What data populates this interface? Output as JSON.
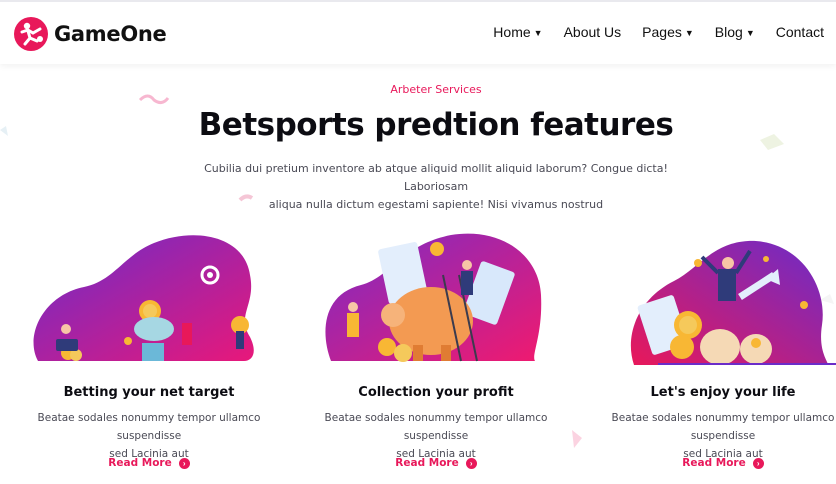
{
  "brand": {
    "name": "GameOne",
    "accent": "#e8185a",
    "purple": "#6b2cc9"
  },
  "nav": {
    "items": [
      {
        "label": "Home",
        "dropdown": true
      },
      {
        "label": "About Us",
        "dropdown": false
      },
      {
        "label": "Pages",
        "dropdown": true
      },
      {
        "label": "Blog",
        "dropdown": true
      },
      {
        "label": "Contact",
        "dropdown": false
      }
    ]
  },
  "hero": {
    "eyebrow": "Arbeter Services",
    "title": "Betsports predtion features",
    "lead_line1": "Cubilia dui pretium inventore ab atque aliquid mollit aliquid laborum? Congue dicta! Laboriosam",
    "lead_line2": "aliqua nulla dictum egestami sapiente! Nisi vivamus nostrud"
  },
  "features": [
    {
      "title": "Betting your net target",
      "desc_line1": "Beatae sodales nonummy tempor ullamco suspendisse",
      "desc_line2": "sed Lacinia aut",
      "link": "Read More",
      "icon": "gear-coins-illustration"
    },
    {
      "title": "Collection your profit",
      "desc_line1": "Beatae sodales nonummy tempor ullamco suspendisse",
      "desc_line2": "sed Lacinia aut",
      "link": "Read More",
      "icon": "piggy-bank-illustration"
    },
    {
      "title": "Let's enjoy your life",
      "desc_line1": "Beatae sodales nonummy tempor ullamco suspendisse",
      "desc_line2": "sed Lacinia aut",
      "link": "Read More",
      "icon": "money-bags-illustration"
    }
  ]
}
